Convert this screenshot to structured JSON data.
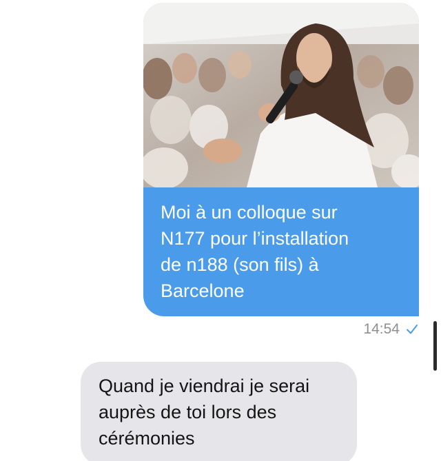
{
  "conversation": {
    "outgoing": {
      "photo_alt": "",
      "text": "Moi à un colloque sur\nN177 pour l’installation\nde n188 (son fils) à\nBarcelone",
      "time": "14:54",
      "status_icon": "check-icon"
    },
    "incoming": {
      "text": "Quand je viendrai je serai\nauprès de toi lors des\ncérémonies"
    }
  },
  "colors": {
    "outgoing_bubble": "#4a9cea",
    "incoming_bubble": "#e6e6ea",
    "timestamp": "#8e8e93",
    "check": "#4a9cea"
  }
}
